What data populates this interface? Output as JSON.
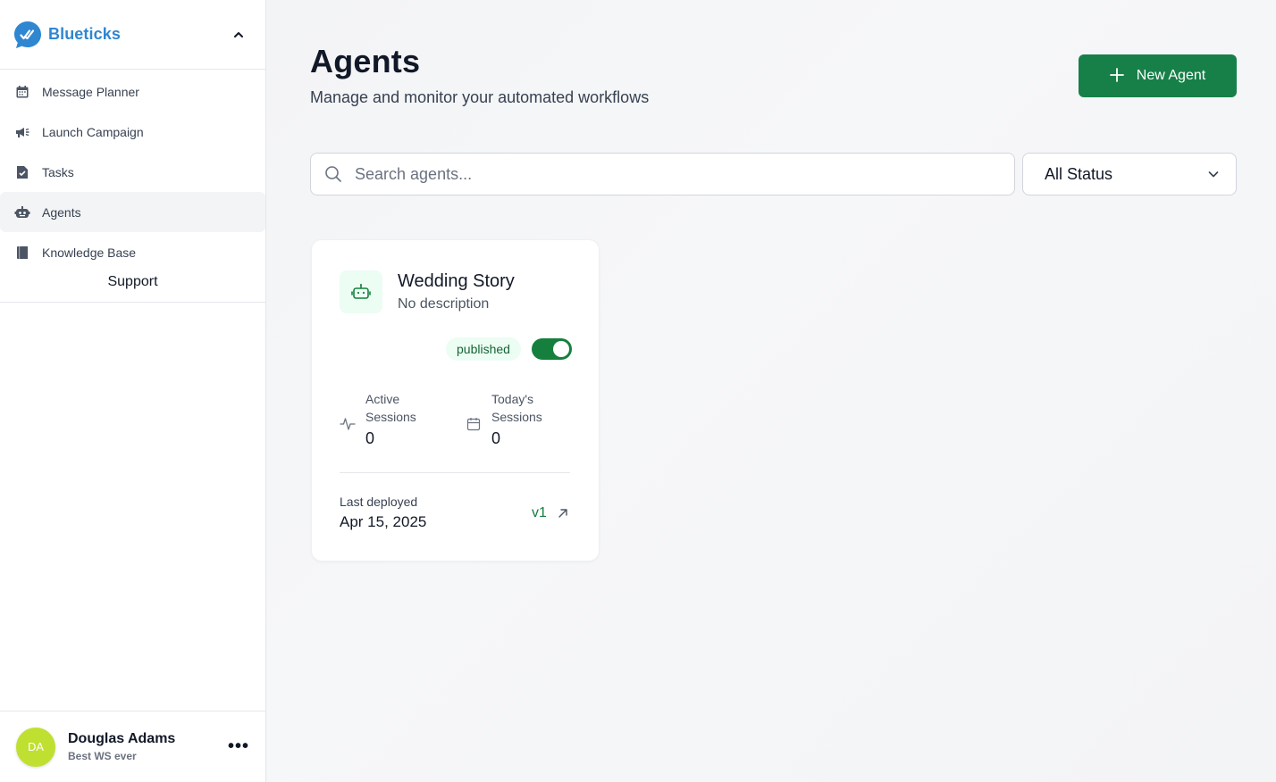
{
  "sidebar": {
    "brand": {
      "name": "Blueticks",
      "logo_icon": "blueticks-logo-icon",
      "toggle_icon": "chevron-up-icon"
    },
    "items": [
      {
        "label": "Message Planner",
        "icon": "calendar-icon"
      },
      {
        "label": "Launch Campaign",
        "icon": "megaphone-icon"
      },
      {
        "label": "Tasks",
        "icon": "task-icon"
      },
      {
        "label": "Agents",
        "icon": "robot-icon",
        "active": true
      },
      {
        "label": "Knowledge Base",
        "icon": "book-icon"
      }
    ],
    "support_label": "Support",
    "user": {
      "initials": "DA",
      "name": "Douglas Adams",
      "subtitle": "Best WS ever",
      "menu_label": "•••"
    }
  },
  "header": {
    "title": "Agents",
    "subtitle": "Manage and monitor your automated workflows",
    "new_button_label": "New Agent",
    "new_button_icon": "plus-icon"
  },
  "filters": {
    "search_placeholder": "Search agents...",
    "search_value": "",
    "status_value": "All Status"
  },
  "agents": [
    {
      "name": "Wedding Story",
      "description": "No description",
      "status": "published",
      "enabled": true,
      "active_sessions_label": "Active Sessions",
      "active_sessions_value": "0",
      "todays_sessions_label": "Today's Sessions",
      "todays_sessions_value": "0",
      "last_deployed_label": "Last deployed",
      "last_deployed_date": "Apr 15, 2025",
      "version": "v1"
    }
  ],
  "colors": {
    "brand_blue": "#2f86d1",
    "primary_green": "#178049",
    "badge_bg": "#ecfdf3",
    "avatar": "#bfe030"
  }
}
